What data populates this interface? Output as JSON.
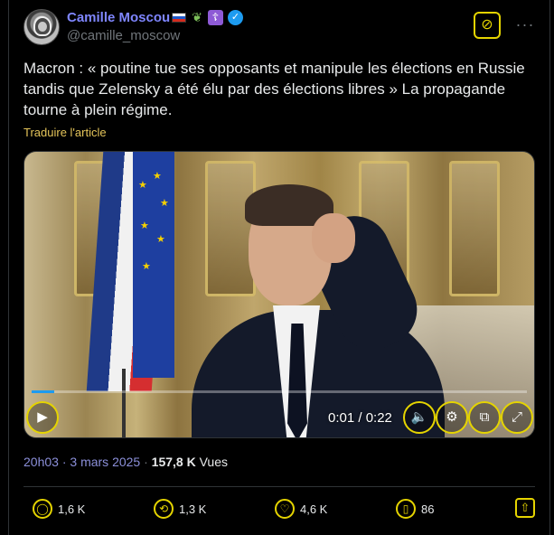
{
  "author": {
    "display_name": "Camille Moscou",
    "handle": "@camille_moscow",
    "badges": [
      "russia-flag-icon",
      "leaf-icon",
      "orthodox-cross-icon",
      "verified-icon"
    ]
  },
  "header": {
    "grok_icon": "grok-icon",
    "more_icon": "more-icon"
  },
  "tweet": {
    "text": "Macron : « poutine tue ses opposants et manipule les élections en Russie tandis que Zelensky a été élu par des élections libres » La propagande tourne à plein régime.",
    "translate_label": "Traduire l'article"
  },
  "video": {
    "current_time": "0:01",
    "duration": "0:22",
    "time_display": "0:01 / 0:22",
    "progress_fraction": 0.045,
    "controls": [
      "play-icon",
      "volume-icon",
      "settings-icon",
      "popout-icon",
      "fullscreen-icon"
    ]
  },
  "meta": {
    "time": "20h03",
    "separator": "·",
    "date": "3 mars 2025",
    "views": "157,8 K",
    "views_label": "Vues"
  },
  "actions": {
    "replies": "1,6 K",
    "reposts": "1,3 K",
    "likes": "4,6 K",
    "bookmarks": "86"
  },
  "colors": {
    "accent_yellow": "#e5d400",
    "name_color": "#7f86ff",
    "background": "#000000",
    "text": "#e7e9ea",
    "muted": "#71767b"
  }
}
